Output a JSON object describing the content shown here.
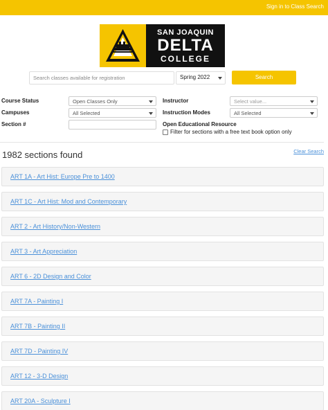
{
  "header": {
    "signin_link": "Sign in to Class Search",
    "accent_color": "#f5c400"
  },
  "logo": {
    "line1": "SAN JOAQUIN",
    "line2": "DELTA",
    "line3": "COLLEGE"
  },
  "search": {
    "placeholder": "Search classes available for registration",
    "term_value": "Spring 2022",
    "button_label": "Search"
  },
  "filters": {
    "course_status_label": "Course Status",
    "course_status_value": "Open Classes Only",
    "campuses_label": "Campuses",
    "campuses_value": "All Selected",
    "section_label": "Section #",
    "instructor_label": "Instructor",
    "instructor_placeholder": "Select value...",
    "instruction_modes_label": "Instruction Modes",
    "instruction_modes_value": "All Selected",
    "oer_label": "Open Educational Resource",
    "oer_checkbox_label": "Filter for sections with a free text book option only",
    "oer_checked": false
  },
  "results": {
    "count_text": "1982 sections found",
    "clear_label": "Clear Search",
    "link_color": "#4a90d9",
    "items": [
      "ART 1A - Art Hist: Europe Pre to 1400",
      "ART 1C - Art Hist: Mod and Contemporary",
      "ART 2 - Art History/Non-Western",
      "ART 3 - Art Appreciation",
      "ART 6 - 2D Design and Color",
      "ART 7A - Painting I",
      "ART 7B - Painting II",
      "ART 7D - Painting IV",
      "ART 12 - 3-D Design",
      "ART 20A - Sculpture I"
    ]
  }
}
